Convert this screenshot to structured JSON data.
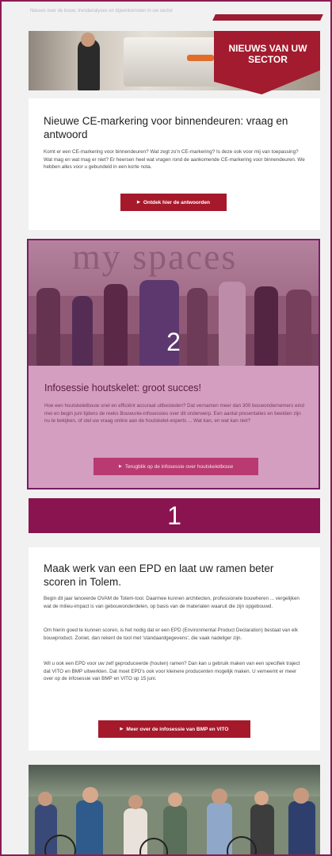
{
  "preheader": "Nieuws over de bouw, trendanalyses en bijeenkomsten in uw sector",
  "banner": {
    "line1": "NIEUWS VAN UW",
    "line2": "SECTOR"
  },
  "article1": {
    "title": "Nieuwe CE-markering voor binnendeuren: vraag en antwoord",
    "body": "Komt er een CE-markering voor binnendeuren? Wat zegt zo'n CE-markering? Is deze ook voor mij van toepassing? Wat mag en wat mag er niet? Er heersen heel wat vragen rond de aankomende CE-markering voor binnendeuren. We hebben alles voor u gebundeld in een korte nota.",
    "button": "Ontdek hier de antwoorden"
  },
  "article2": {
    "photo_text": "my spaces",
    "title": "Infosessie houtskelet: groot succes!",
    "body": "Hoe een houtskeletbouw snel en efficiënt accuraat uitbesteden? Dat vernamen meer dan 300 bouwondernemers eind mei en begin juni tijdens de reeks Bouwunie-infosessies over dit onderwerp. Een aantal presentaties en beelden zijn nu te bekijken, of stel uw vraag online aan de houtskelet-experts ... Wat kan, en wat kan niet?",
    "button": "Terugblik op de infosessie over houtskeletbouw",
    "overlay_label": "2"
  },
  "bar_label": "1",
  "article3": {
    "title": "Maak werk van een EPD en laat uw ramen beter scoren in Tolem.",
    "para1": "Begin dit jaar lanceerde OVAM de Totem-tool. Daarmee kunnen architecten, professionele bouwheren ... vergelijken wat de milieu-impact is van gebouwonderdelen, op basis van de materialen waaruit die zijn opgebouwd.",
    "para2": "Om hierin goed te kunnen scoren, is het nodig dat er een EPD (Environmental Product Declaration) bestaat van elk bouwproduct. Zoniet, dan rekent de tool met 'standaardgegevens', die vaak nadeliger zijn.",
    "para3": "Wil u ook een EPD voor uw zelf geproduceerde (houten) ramen? Dan kan u gebruik maken van een specifiek traject dat VITO en BMP uitwerkten. Dat moet EPD's ook voor kleinere producenten mogelijk maken. U verneemt er meer over op de infosessie van BMP en VITO op 15 juni.",
    "button": "Meer over de infosessie van BMP en VITO"
  },
  "colors": {
    "brand": "#a5192b",
    "highlight": "#8a1450",
    "overlay": "#d49ec0"
  }
}
